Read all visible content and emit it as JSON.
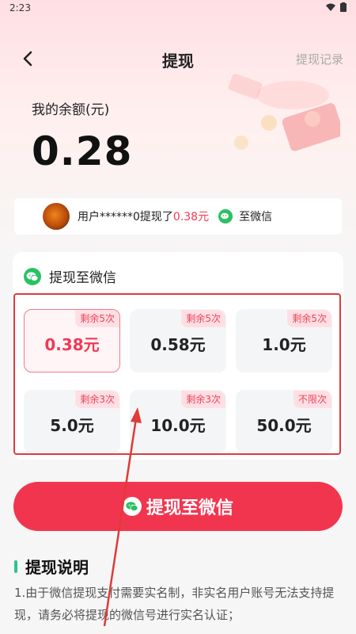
{
  "status_bar": {
    "time": "2:23"
  },
  "nav": {
    "title": "提现",
    "right_label": "提现记录"
  },
  "balance": {
    "label": "我的余额(元)",
    "value": "0.28"
  },
  "notice": {
    "prefix": "用户******0提现了",
    "amount": "0.38元",
    "destination": "至微信"
  },
  "card": {
    "title": "提现至微信",
    "options": [
      {
        "amount": "0.38元",
        "badge": "剩余5次",
        "selected": true
      },
      {
        "amount": "0.58元",
        "badge": "剩余5次",
        "selected": false
      },
      {
        "amount": "1.0元",
        "badge": "剩余5次",
        "selected": false
      },
      {
        "amount": "5.0元",
        "badge": "剩余3次",
        "selected": false
      },
      {
        "amount": "10.0元",
        "badge": "剩余3次",
        "selected": false
      },
      {
        "amount": "50.0元",
        "badge": "不限次",
        "selected": false
      }
    ]
  },
  "main_button": {
    "label": "提现至微信"
  },
  "description": {
    "title": "提现说明",
    "text": "1.由于微信提现支付需要实名制，非实名用户账号无法支持提现，请务必将提现的微信号进行实名认证；"
  },
  "colors": {
    "accent": "#f2354f",
    "wechat": "#2ac163",
    "annotation": "#e03a3a"
  }
}
